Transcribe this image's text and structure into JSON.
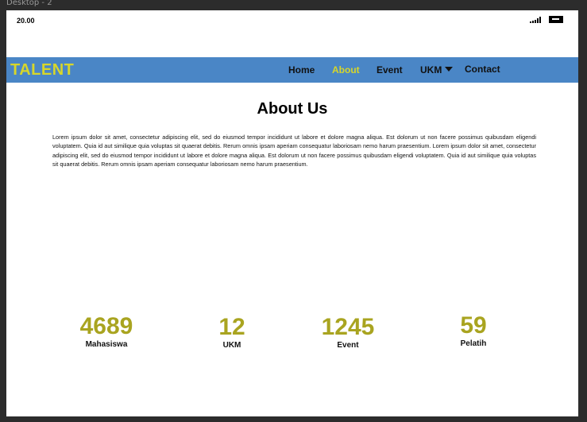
{
  "canvas": {
    "frame_label": "Desktop - 2"
  },
  "status_bar": {
    "time": "20.00"
  },
  "nav": {
    "brand": "TALENT",
    "items": [
      {
        "label": "Home",
        "active": false
      },
      {
        "label": "About",
        "active": true
      },
      {
        "label": "Event",
        "active": false
      },
      {
        "label": "UKM",
        "active": false,
        "has_dropdown": true
      },
      {
        "label": "Contact",
        "active": false
      }
    ]
  },
  "about": {
    "title": "About Us",
    "body": "Lorem ipsum dolor sit amet, consectetur adipiscing elit, sed do eiusmod tempor incididunt ut labore et dolore magna aliqua. Est dolorum ut non facere possimus quibusdam eligendi voluptatem. Quia id aut similique quia voluptas sit quaerat debitis. Rerum omnis ipsam aperiam consequatur laboriosam nemo harum praesentium. Lorem ipsum dolor sit amet, consectetur adipiscing elit, sed do eiusmod tempor incididunt ut labore et dolore magna aliqua. Est dolorum ut non facere possimus quibusdam eligendi voluptatem. Quia id aut similique quia voluptas sit quaerat debitis. Rerum omnis ipsam aperiam consequatur laboriosam nemo harum praesentium."
  },
  "stats": [
    {
      "value": "4689",
      "label": "Mahasiswa"
    },
    {
      "value": "12",
      "label": "UKM"
    },
    {
      "value": "1245",
      "label": "Event"
    },
    {
      "value": "59",
      "label": "Pelatih"
    }
  ],
  "colors": {
    "navbar_bg": "#4a86c6",
    "brand_accent": "#d7d62a",
    "stat_value": "#a9a420"
  }
}
